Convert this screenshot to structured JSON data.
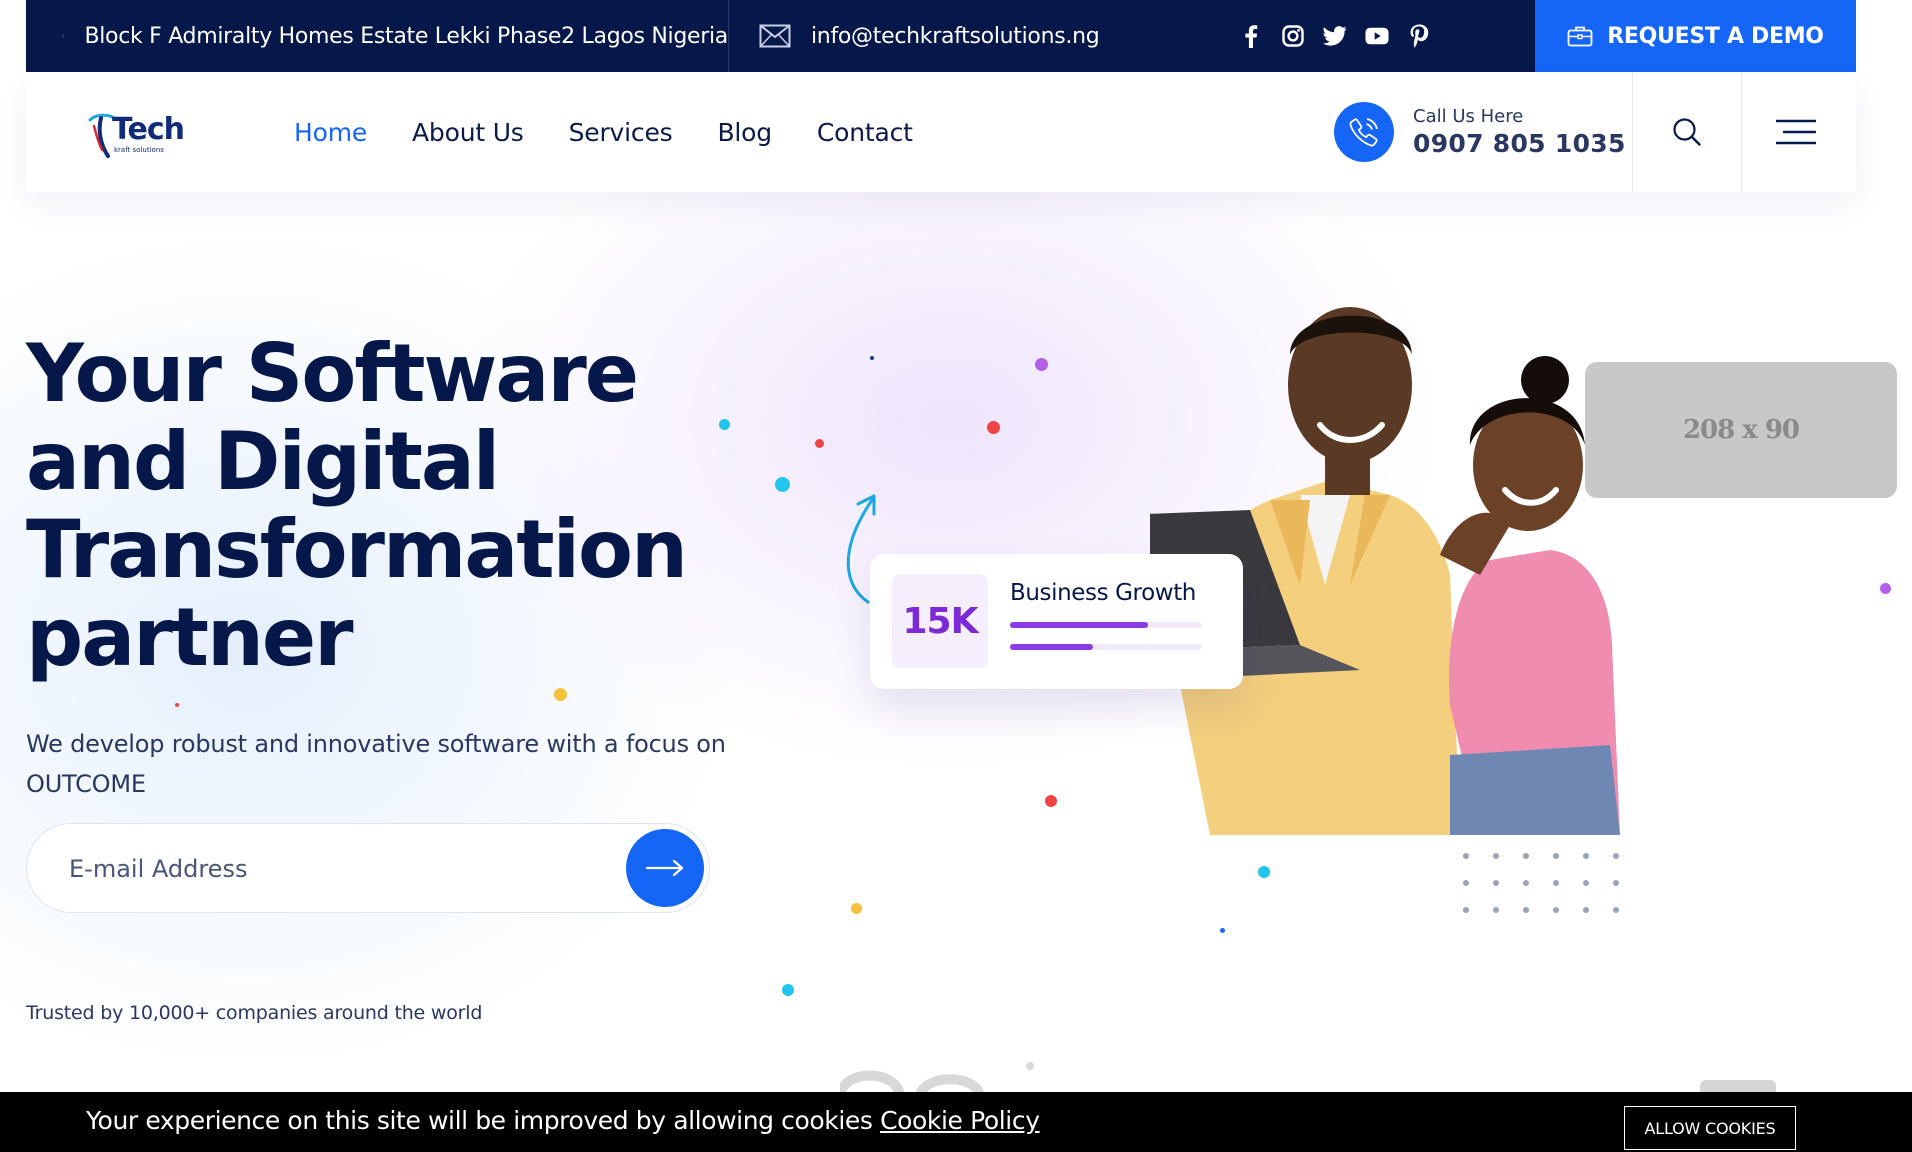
{
  "topbar": {
    "address": "Block F Admiralty Homes Estate Lekki Phase2 Lagos Nigeria",
    "email": "info@techkraftsolutions.ng",
    "social_icons": [
      "facebook-icon",
      "instagram-icon",
      "twitter-icon",
      "youtube-icon",
      "pinterest-icon"
    ],
    "demo_label": "REQUEST A DEMO"
  },
  "brand": {
    "logo_text": "Tech",
    "logo_sub": "kraft solutions"
  },
  "nav": {
    "items": [
      {
        "label": "Home",
        "active": true
      },
      {
        "label": "About Us",
        "active": false
      },
      {
        "label": "Services",
        "active": false
      },
      {
        "label": "Blog",
        "active": false
      },
      {
        "label": "Contact",
        "active": false
      }
    ],
    "call_label": "Call Us Here",
    "call_number": "0907 805 1035"
  },
  "hero": {
    "title_lines": [
      "Your Software",
      "and Digital",
      "Transformation",
      "partner"
    ],
    "subtitle": "We develop robust and innovative software with a focus on OUTCOME",
    "email_placeholder": "E-mail Address",
    "trusted": "Trusted by 10,000+ companies around the world"
  },
  "growth_card": {
    "value": "15K",
    "title": "Business Growth",
    "bars": [
      0.72,
      0.43
    ]
  },
  "ad_placeholder": "208 x 90",
  "cookie": {
    "text": "Your experience on this site will be improved by allowing cookies",
    "link": "Cookie Policy",
    "button": "ALLOW COOKIES"
  },
  "colors": {
    "navy": "#06174a",
    "accent": "#1566f6",
    "purple": "#8b3ae6"
  }
}
